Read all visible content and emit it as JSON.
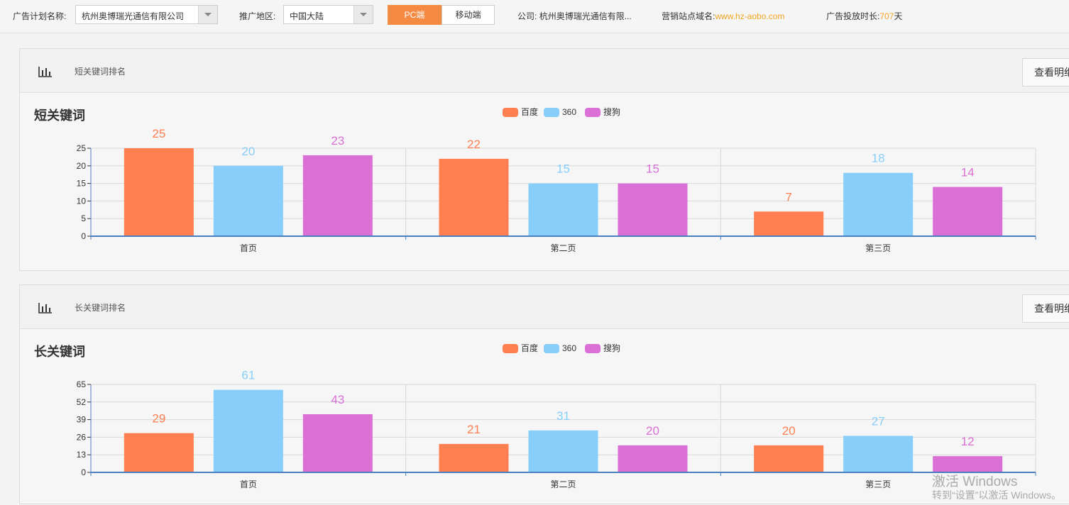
{
  "topbar": {
    "plan_label": "广告计划名称:",
    "plan_value": "杭州奥博瑞光通信有限公司",
    "region_label": "推广地区:",
    "region_value": "中国大陆",
    "pc_label": "PC端",
    "mobile_label": "移动端",
    "company_label": "公司:",
    "company_value": "杭州奥博瑞光通信有限...",
    "domain_label": "营销站点域名:",
    "domain_value": "www.hz-aobo.com",
    "duration_label": "广告投放时长:",
    "duration_value": "707",
    "duration_unit": "天"
  },
  "panels": [
    {
      "header_title": "短关键词排名",
      "detail_label": "查看明细"
    },
    {
      "header_title": "长关键词排名",
      "detail_label": "查看明细"
    }
  ],
  "chart_data": [
    {
      "type": "bar",
      "title": "短关键词",
      "categories": [
        "首页",
        "第二页",
        "第三页"
      ],
      "series": [
        {
          "name": "百度",
          "color": "#ff7f50",
          "values": [
            25,
            22,
            7
          ]
        },
        {
          "name": "360",
          "color": "#87cefa",
          "values": [
            20,
            15,
            18
          ]
        },
        {
          "name": "搜狗",
          "color": "#da70d6",
          "values": [
            23,
            15,
            14
          ]
        }
      ],
      "yticks": [
        0,
        5,
        10,
        15,
        20,
        25
      ],
      "ylim": [
        0,
        25
      ],
      "grid": true,
      "legend": "top-center"
    },
    {
      "type": "bar",
      "title": "长关键词",
      "categories": [
        "首页",
        "第二页",
        "第三页"
      ],
      "series": [
        {
          "name": "百度",
          "color": "#ff7f50",
          "values": [
            29,
            21,
            20
          ]
        },
        {
          "name": "360",
          "color": "#87cefa",
          "values": [
            61,
            31,
            27
          ]
        },
        {
          "name": "搜狗",
          "color": "#da70d6",
          "values": [
            43,
            20,
            12
          ]
        }
      ],
      "yticks": [
        0,
        13,
        26,
        39,
        52,
        65
      ],
      "ylim": [
        0,
        65
      ],
      "grid": true,
      "legend": "top-center"
    }
  ],
  "watermark": {
    "line1": "激活 Windows",
    "line2": "转到“设置”以激活 Windows。"
  }
}
